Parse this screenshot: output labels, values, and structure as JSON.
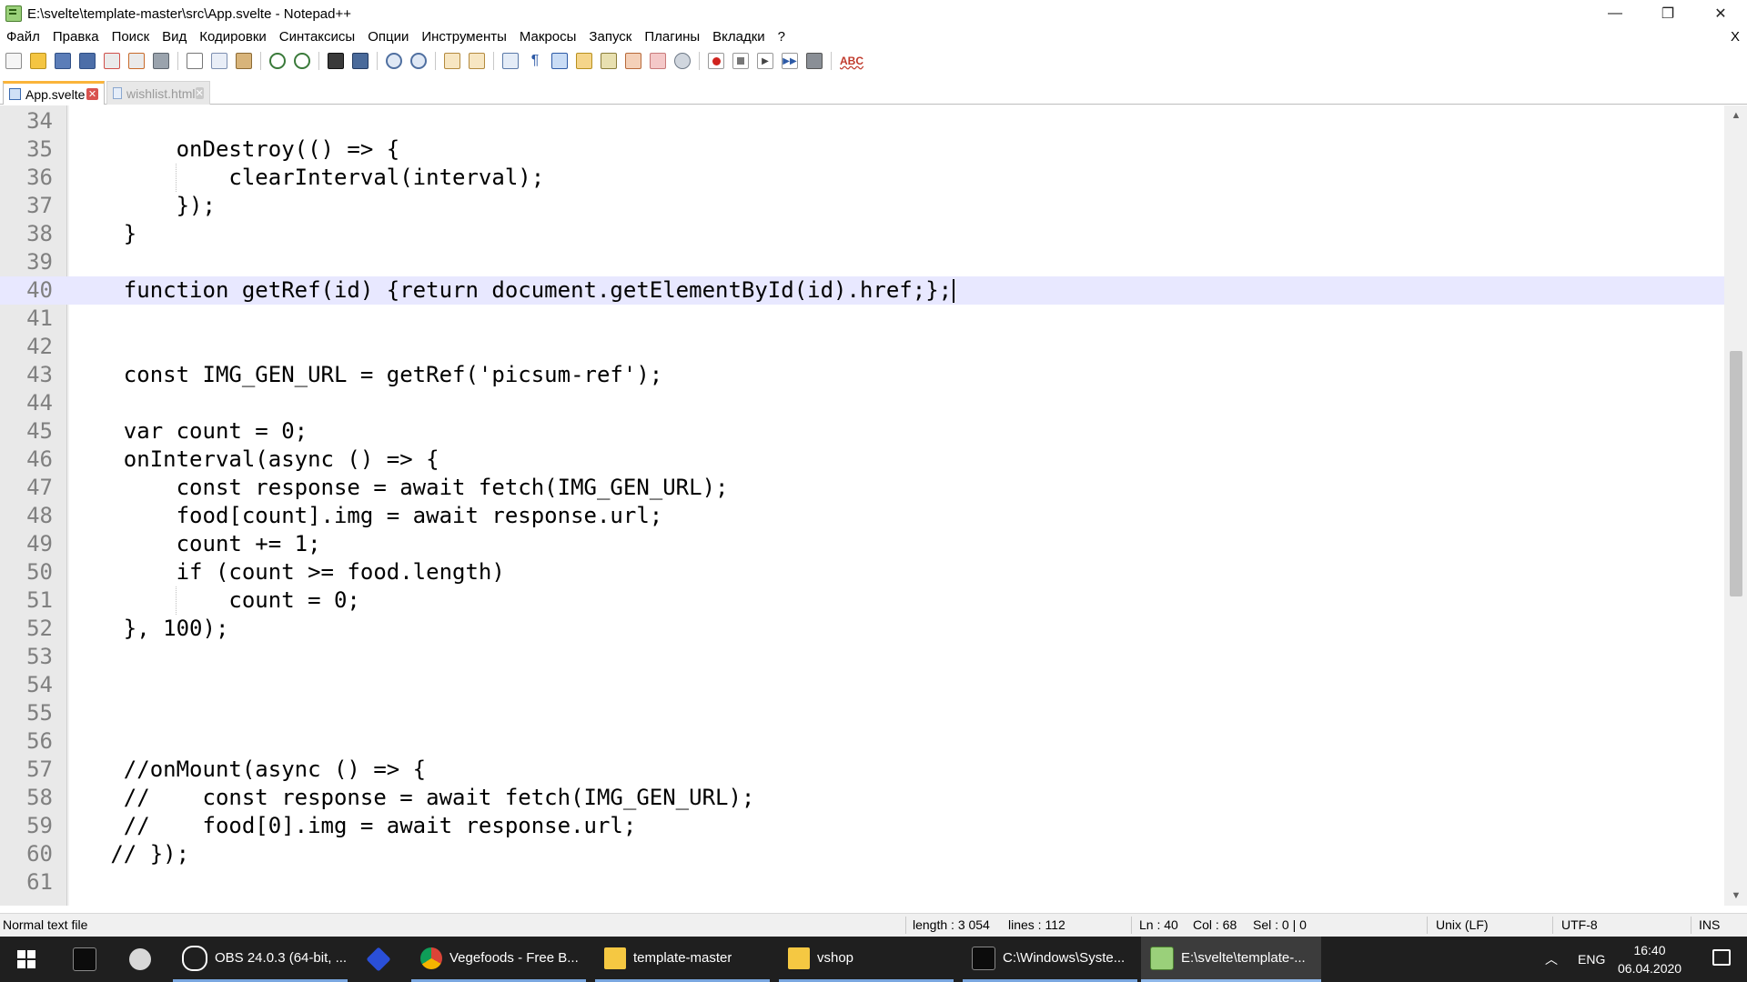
{
  "window": {
    "title": "E:\\svelte\\template-master\\src\\App.svelte - Notepad++",
    "minimize": "—",
    "maximize": "❐",
    "close": "✕"
  },
  "menu": {
    "items": [
      "Файл",
      "Правка",
      "Поиск",
      "Вид",
      "Кодировки",
      "Синтаксисы",
      "Опции",
      "Инструменты",
      "Макросы",
      "Запуск",
      "Плагины",
      "Вкладки",
      "?"
    ],
    "close": "X"
  },
  "toolbar": {
    "icons": [
      "new-file-icon",
      "open-file-icon",
      "save-icon",
      "save-all-icon",
      "close-icon",
      "close-all-icon",
      "print-icon",
      "cut-icon",
      "copy-icon",
      "paste-icon",
      "undo-icon",
      "redo-icon",
      "find-icon",
      "replace-icon",
      "zoom-in-icon",
      "zoom-out-icon",
      "sync-v-icon",
      "sync-h-icon",
      "word-wrap-icon",
      "show-all-chars-icon",
      "indent-guide-icon",
      "doc-map-icon",
      "function-list-icon",
      "folder-workspace-icon",
      "doc-list-icon",
      "monitor-icon",
      "record-macro-icon",
      "stop-macro-icon",
      "play-macro-icon",
      "run-macro-multiple-icon",
      "save-macro-icon",
      "spellcheck-icon"
    ],
    "spellcheck_label": "ABC"
  },
  "tabs": [
    {
      "label": "App.svelte",
      "active": true
    },
    {
      "label": "wishlist.html",
      "active": false
    }
  ],
  "editor": {
    "current_line": 40,
    "lines": [
      {
        "n": "34",
        "text": ""
      },
      {
        "n": "35",
        "text": "        onDestroy(() => {"
      },
      {
        "n": "36",
        "text": "            clearInterval(interval);"
      },
      {
        "n": "37",
        "text": "        });"
      },
      {
        "n": "38",
        "text": "    }"
      },
      {
        "n": "39",
        "text": ""
      },
      {
        "n": "40",
        "text": "    function getRef(id) {return document.getElementById(id).href;};"
      },
      {
        "n": "41",
        "text": ""
      },
      {
        "n": "42",
        "text": ""
      },
      {
        "n": "43",
        "text": "    const IMG_GEN_URL = getRef('picsum-ref');"
      },
      {
        "n": "44",
        "text": ""
      },
      {
        "n": "45",
        "text": "    var count = 0;"
      },
      {
        "n": "46",
        "text": "    onInterval(async () => {"
      },
      {
        "n": "47",
        "text": "        const response = await fetch(IMG_GEN_URL);"
      },
      {
        "n": "48",
        "text": "        food[count].img = await response.url;"
      },
      {
        "n": "49",
        "text": "        count += 1;"
      },
      {
        "n": "50",
        "text": "        if (count >= food.length)"
      },
      {
        "n": "51",
        "text": "            count = 0;"
      },
      {
        "n": "52",
        "text": "    }, 100);"
      },
      {
        "n": "53",
        "text": ""
      },
      {
        "n": "54",
        "text": ""
      },
      {
        "n": "55",
        "text": ""
      },
      {
        "n": "56",
        "text": ""
      },
      {
        "n": "57",
        "text": "    //onMount(async () => {"
      },
      {
        "n": "58",
        "text": "    //    const response = await fetch(IMG_GEN_URL);"
      },
      {
        "n": "59",
        "text": "    //    food[0].img = await response.url;"
      },
      {
        "n": "60",
        "text": "   // });"
      },
      {
        "n": "61",
        "text": ""
      }
    ]
  },
  "statusbar": {
    "file_type": "Normal text file",
    "length": "length : 3 054",
    "lines": "lines : 112",
    "ln": "Ln : 40",
    "col": "Col : 68",
    "sel": "Sel : 0 | 0",
    "eol": "Unix (LF)",
    "encoding": "UTF-8",
    "mode": "INS"
  },
  "taskbar": {
    "tasks": [
      {
        "label": "",
        "icon": "cmd-icon"
      },
      {
        "label": "",
        "icon": "paint-app-icon"
      },
      {
        "label": "OBS 24.0.3 (64-bit, ...",
        "icon": "obs-icon"
      },
      {
        "label": "",
        "icon": "diamond-app-icon"
      },
      {
        "label": "Vegefoods - Free B...",
        "icon": "chrome-icon"
      },
      {
        "label": "template-master",
        "icon": "folder-icon"
      },
      {
        "label": "vshop",
        "icon": "folder-icon"
      },
      {
        "label": "C:\\Windows\\Syste...",
        "icon": "terminal-icon"
      },
      {
        "label": "E:\\svelte\\template-...",
        "icon": "notepadpp-icon"
      }
    ],
    "tray_lang": "ENG",
    "time": "16:40",
    "date": "06.04.2020"
  },
  "colors": {
    "current_line": "#e8e8ff",
    "tab_accent": "#fab43a",
    "gutter": "#e9e9e9",
    "taskbar": "#1f1f1f"
  }
}
